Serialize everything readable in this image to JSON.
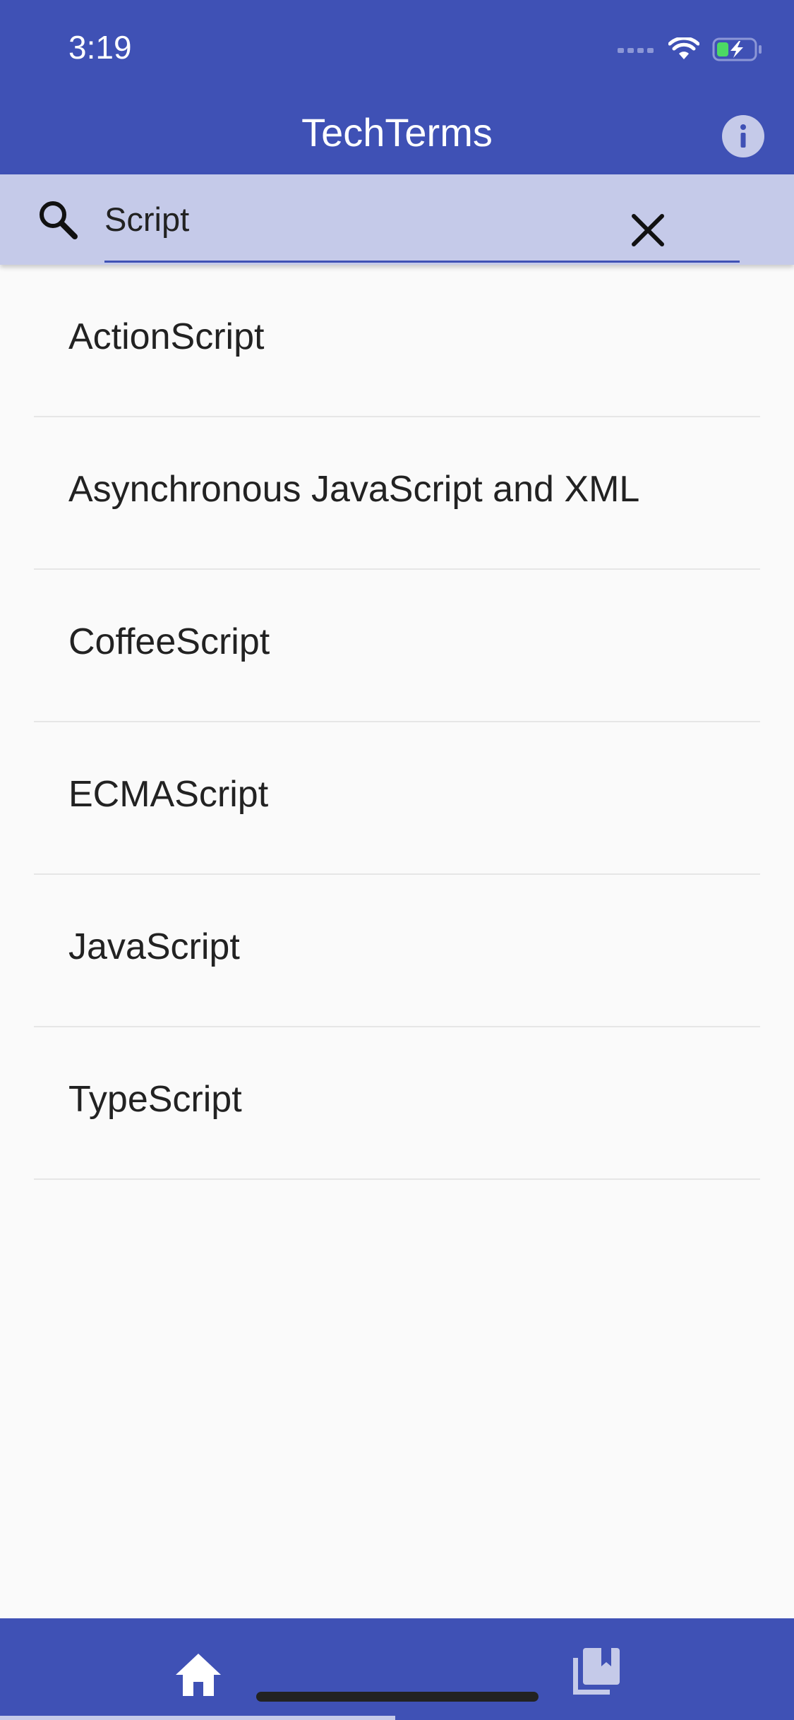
{
  "status_bar": {
    "time": "3:19"
  },
  "app_bar": {
    "title": "TechTerms",
    "info_icon": "info-icon"
  },
  "search": {
    "value": "Script",
    "search_icon": "search-icon",
    "clear_icon": "close-icon"
  },
  "results": [
    {
      "label": "ActionScript"
    },
    {
      "label": "Asynchronous JavaScript and XML"
    },
    {
      "label": "CoffeeScript"
    },
    {
      "label": "ECMAScript"
    },
    {
      "label": "JavaScript"
    },
    {
      "label": "TypeScript"
    }
  ],
  "bottom_nav": {
    "items": [
      {
        "icon": "home-icon",
        "active": true
      },
      {
        "icon": "library-bookmarks-icon",
        "active": false
      }
    ]
  },
  "colors": {
    "primary": "#3f51b5",
    "search_background": "#c5cae9",
    "page_background": "#fafafa",
    "text": "#222222"
  }
}
